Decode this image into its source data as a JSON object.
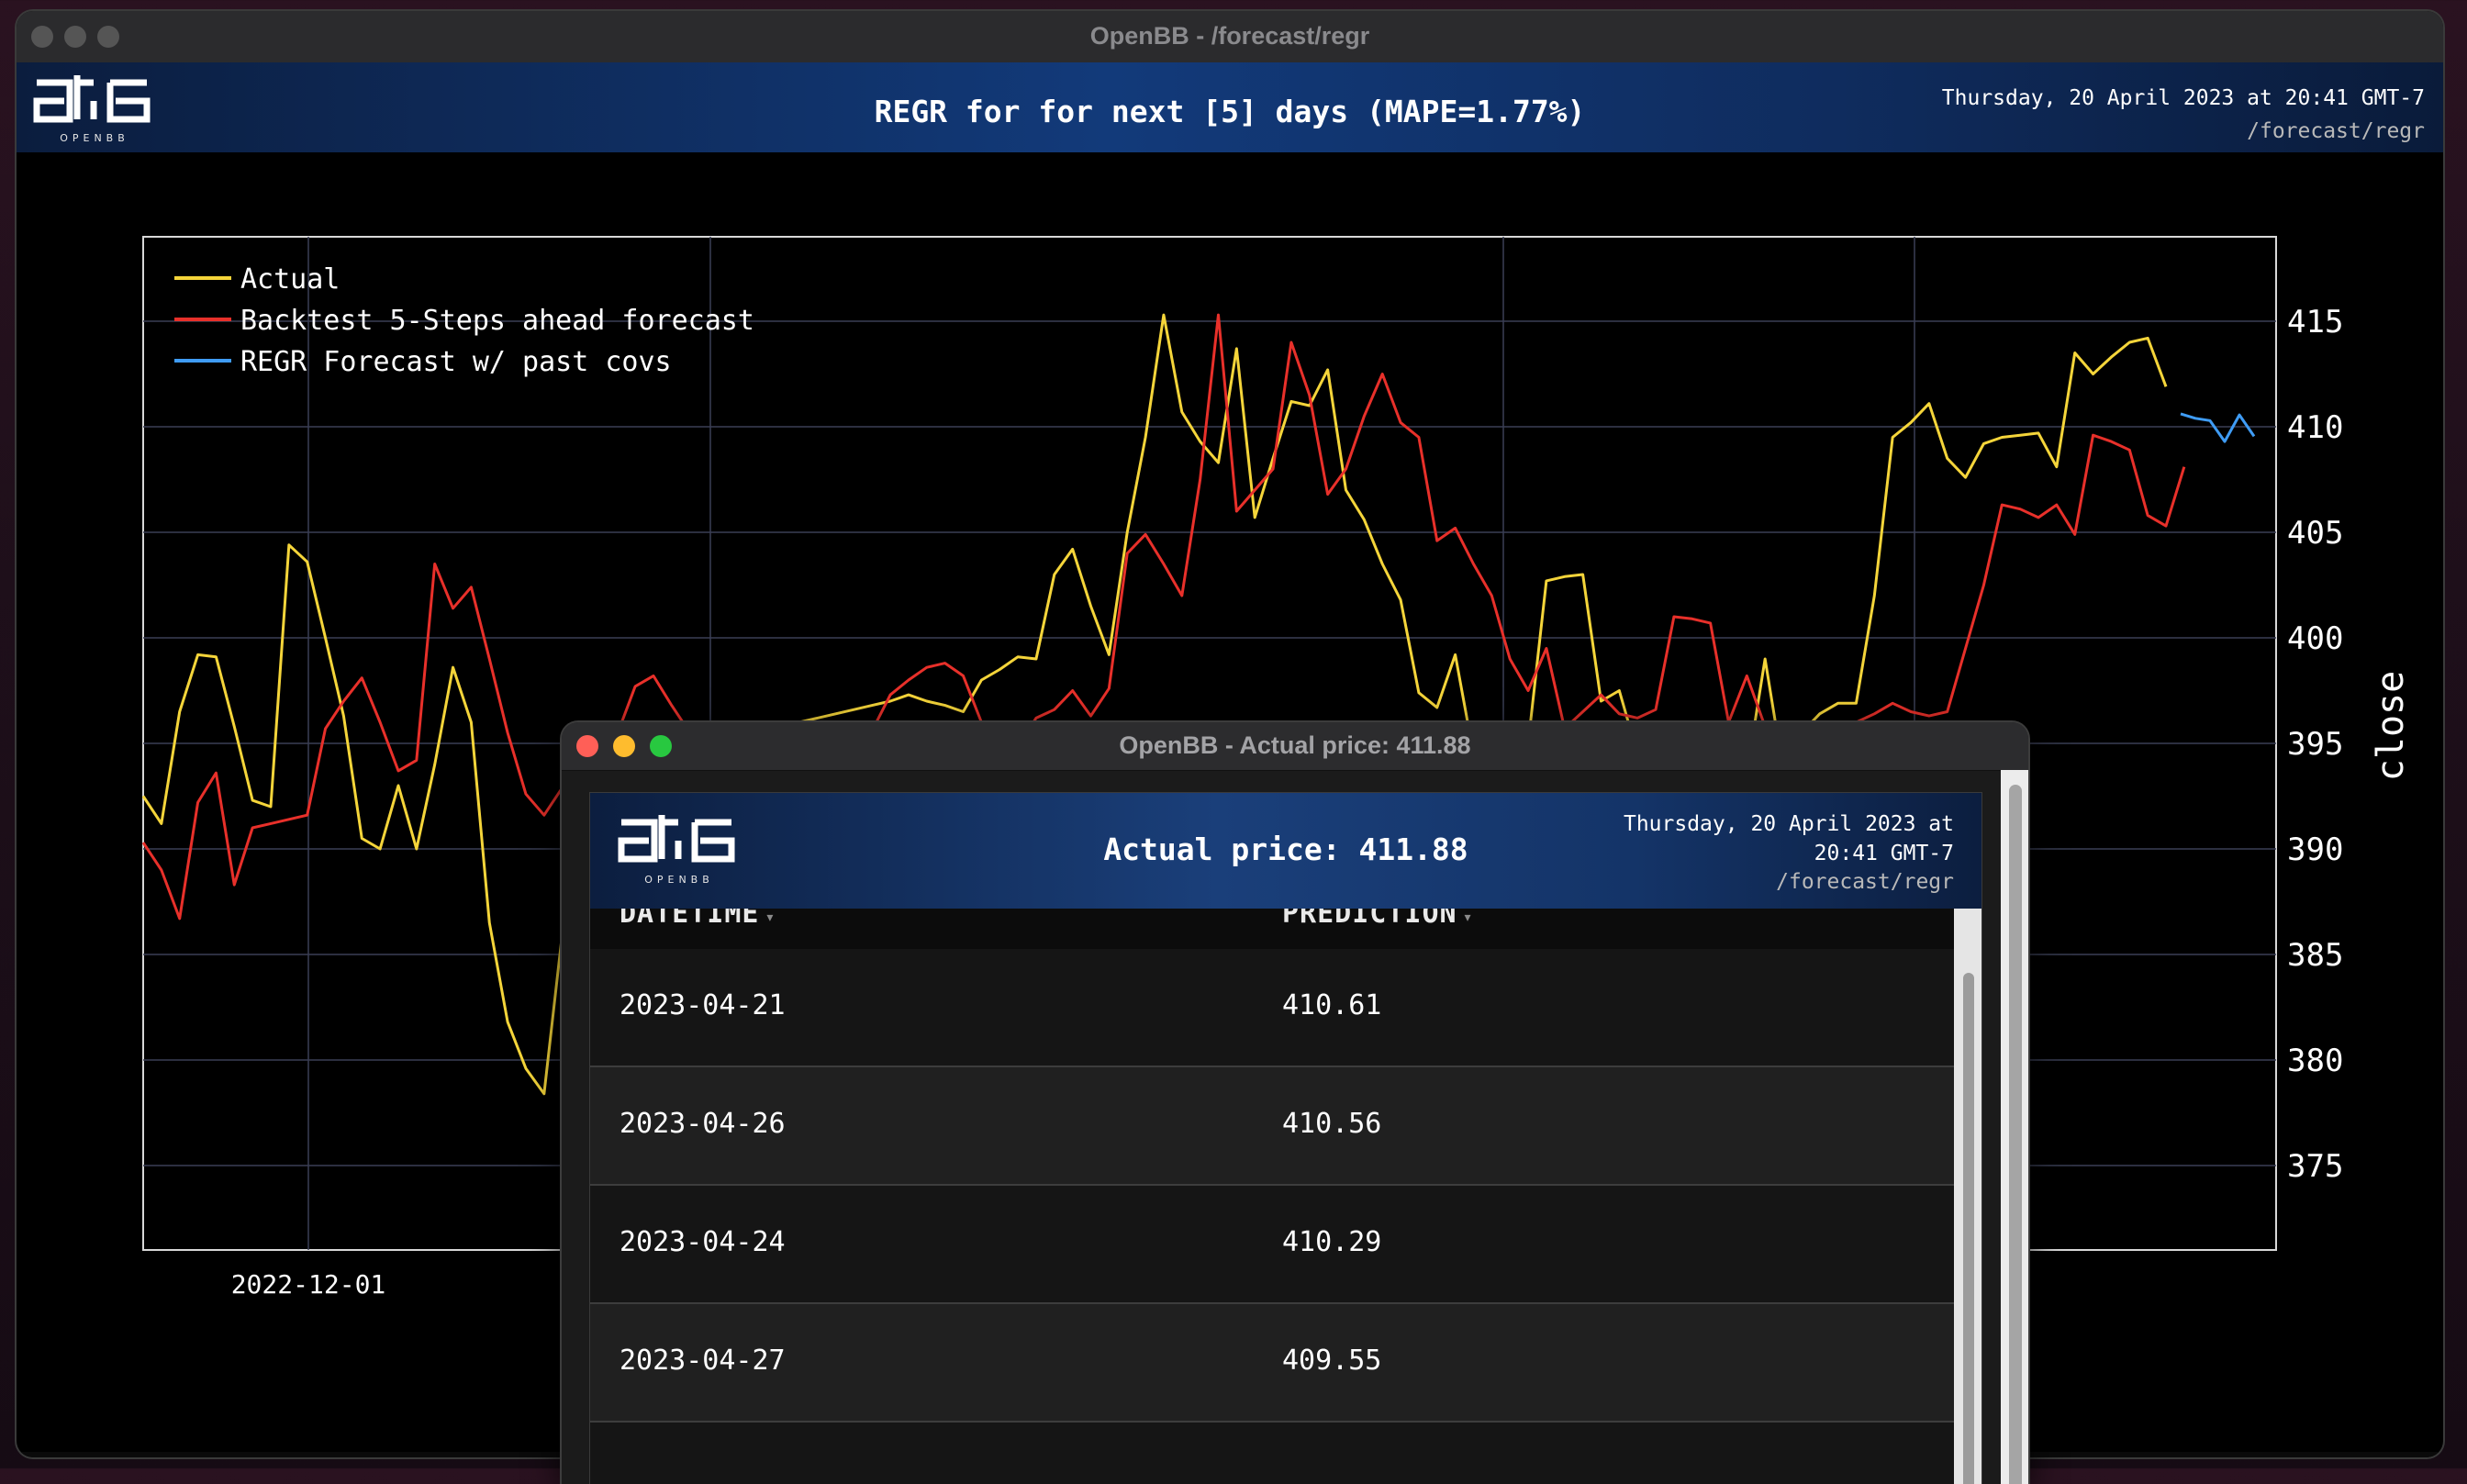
{
  "main_window": {
    "title": "OpenBB - /forecast/regr",
    "logo_text": "OPENBB",
    "header_title": "REGR for for next [5] days (MAPE=1.77%)",
    "header_date": "Thursday, 20 April 2023 at 20:41 GMT-7",
    "header_route": "/forecast/regr"
  },
  "chart_data": {
    "type": "line",
    "title": "",
    "ylabel": "close",
    "xlabel": "",
    "ylim": [
      371,
      419
    ],
    "x_ticks": [
      "2022-12-01"
    ],
    "y_ticks": [
      375,
      380,
      385,
      390,
      395,
      400,
      405,
      410,
      415
    ],
    "legend": [
      "Actual",
      "Backtest 5-Steps ahead forecast",
      "REGR Forecast w/ past covs"
    ],
    "series": [
      {
        "name": "Actual",
        "color": "#f5d53a",
        "values": [
          392.5,
          391.2,
          396.5,
          399.2,
          399.1,
          395.8,
          392.3,
          392.0,
          404.4,
          403.6,
          400.0,
          396.3,
          390.5,
          390.0,
          393.0,
          390.0,
          394.0,
          398.6,
          396.0,
          386.5,
          381.8,
          379.6,
          378.4,
          386.0,
          389.5,
          391.0,
          392.3,
          392.1,
          392.6,
          393.1,
          393.7,
          394.0,
          394.5,
          395.0,
          395.4,
          395.8,
          396.0,
          396.2,
          396.4,
          396.6,
          396.8,
          397.0,
          397.3,
          397.0,
          396.8,
          396.5,
          398.0,
          398.5,
          399.1,
          399.0,
          403.0,
          404.2,
          401.5,
          399.2,
          405.0,
          409.5,
          415.3,
          410.7,
          409.3,
          408.3,
          413.7,
          405.7,
          408.5,
          411.2,
          411.0,
          412.7,
          407.0,
          405.6,
          403.5,
          401.8,
          397.4,
          396.7,
          399.2,
          394.5,
          393.1,
          394.0,
          395.0,
          402.7,
          402.9,
          403.0,
          397.0,
          397.5,
          394.5,
          394.0,
          393.6,
          393.5,
          393.5,
          393.5,
          393.6,
          399.0,
          393.7,
          395.5,
          396.4,
          396.9,
          396.9,
          402.0,
          409.5,
          410.2,
          411.1,
          408.5,
          407.6,
          409.2,
          409.5,
          409.6,
          409.7,
          408.1,
          413.5,
          412.5,
          413.3,
          414.0,
          414.2,
          411.9
        ]
      },
      {
        "name": "Backtest 5-Steps ahead forecast",
        "color": "#e8302a",
        "values": [
          390.3,
          389.0,
          386.7,
          392.2,
          393.6,
          388.3,
          391.0,
          391.2,
          391.4,
          391.6,
          395.7,
          397.0,
          398.1,
          396.0,
          393.7,
          394.2,
          403.5,
          401.4,
          402.4,
          399.0,
          395.5,
          392.6,
          391.6,
          392.9,
          390.5,
          392.8,
          395.4,
          397.7,
          398.2,
          396.8,
          395.5,
          394.8,
          394.3,
          394.0,
          393.7,
          393.5,
          393.5,
          393.6,
          393.9,
          394.3,
          395.6,
          397.3,
          398.0,
          398.6,
          398.8,
          398.2,
          396.0,
          394.7,
          394.9,
          396.2,
          396.6,
          397.5,
          396.3,
          397.6,
          404.0,
          404.9,
          403.5,
          402.0,
          407.5,
          415.3,
          406.0,
          407.0,
          408.0,
          414.0,
          411.5,
          406.8,
          408.0,
          410.5,
          412.5,
          410.2,
          409.5,
          404.6,
          405.2,
          403.5,
          402.0,
          399.0,
          397.5,
          399.5,
          395.7,
          396.5,
          397.3,
          396.4,
          396.2,
          396.6,
          401.0,
          400.9,
          400.7,
          396.0,
          398.2,
          395.8,
          394.2,
          394.1,
          393.8,
          394.3,
          396.0,
          396.4,
          396.9,
          396.5,
          396.3,
          396.5,
          399.5,
          402.5,
          406.3,
          406.1,
          405.7,
          406.3,
          404.9,
          409.6,
          409.3,
          408.9,
          405.8,
          405.3,
          408.1
        ]
      },
      {
        "name": "REGR Forecast w/ past covs",
        "color": "#3f9cf5",
        "values": [
          410.61,
          410.4,
          410.29,
          409.3,
          410.56,
          409.55
        ]
      }
    ]
  },
  "popup_window": {
    "title": "OpenBB - Actual price: 411.88",
    "logo_text": "OPENBB",
    "header_title": "Actual price: 411.88",
    "header_date": "Thursday, 20 April 2023 at 20:41 GMT-7",
    "header_route": "/forecast/regr",
    "table": {
      "columns": [
        "DATETIME",
        "PREDICTION"
      ],
      "rows": [
        [
          "2023-04-21",
          "410.61"
        ],
        [
          "2023-04-26",
          "410.56"
        ],
        [
          "2023-04-24",
          "410.29"
        ],
        [
          "2023-04-27",
          "409.55"
        ]
      ]
    }
  }
}
